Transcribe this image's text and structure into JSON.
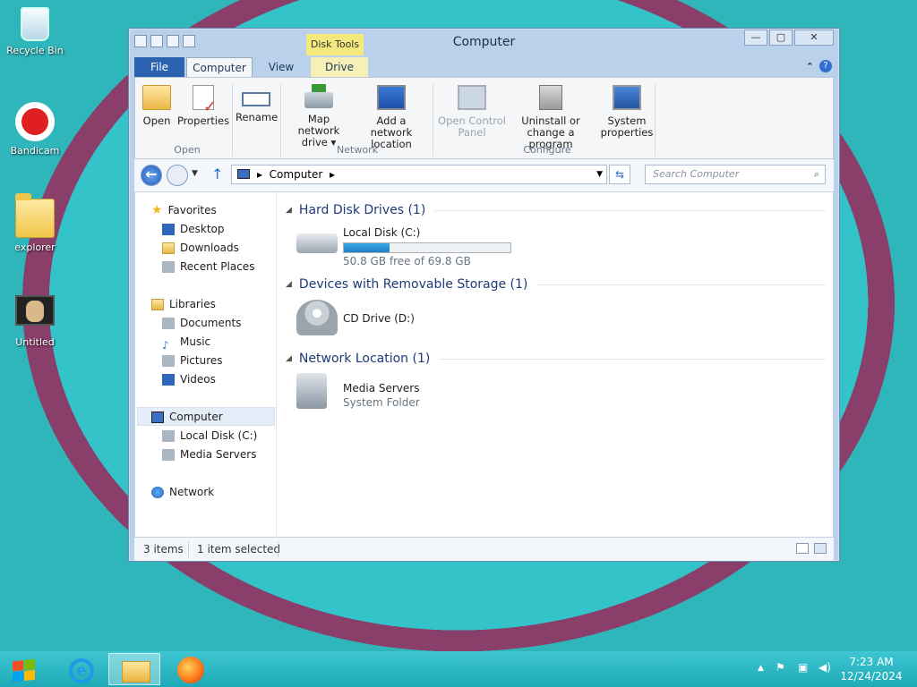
{
  "desktop": {
    "icons": [
      {
        "label": "Recycle Bin"
      },
      {
        "label": "Bandicam"
      },
      {
        "label": "explorer"
      },
      {
        "label": "Untitled"
      }
    ]
  },
  "window": {
    "title": "Computer",
    "context_tab_group": "Disk Tools",
    "tabs": {
      "file": "File",
      "computer": "Computer",
      "view": "View",
      "drive": "Drive"
    },
    "ribbon": {
      "open_group": "Open",
      "network_group": "Network",
      "configure_group": "Configure",
      "open": "Open",
      "properties": "Properties",
      "rename": "Rename",
      "map_network_drive_1": "Map network",
      "map_network_drive_2": "drive ▾",
      "add_network_location_1": "Add a network",
      "add_network_location_2": "location",
      "open_control_panel_1": "Open Control",
      "open_control_panel_2": "Panel",
      "uninstall_1": "Uninstall or",
      "uninstall_2": "change a program",
      "system_properties_1": "System",
      "system_properties_2": "properties"
    },
    "address": {
      "path": "Computer",
      "search_placeholder": "Search Computer"
    },
    "nav": {
      "favorites": "Favorites",
      "desktop": "Desktop",
      "downloads": "Downloads",
      "recent_places": "Recent Places",
      "libraries": "Libraries",
      "documents": "Documents",
      "music": "Music",
      "pictures": "Pictures",
      "videos": "Videos",
      "computer": "Computer",
      "local_disk": "Local Disk (C:)",
      "media_servers": "Media Servers",
      "network": "Network"
    },
    "content": {
      "hdd_header": "Hard Disk Drives (1)",
      "removable_header": "Devices with Removable Storage (1)",
      "network_header": "Network Location (1)",
      "local_disk_name": "Local Disk (C:)",
      "local_disk_free": "50.8 GB free of 69.8 GB",
      "local_disk_used_fraction": 0.272,
      "cd_drive_name": "CD Drive (D:)",
      "media_servers_name": "Media Servers",
      "media_servers_type": "System Folder"
    },
    "status": {
      "items": "3 items",
      "selected": "1 item selected"
    }
  },
  "taskbar": {
    "time": "7:23 AM",
    "date": "12/24/2024",
    "colors": {
      "accent": "#2b63b1",
      "taskbar": "#2fb9c5"
    }
  }
}
